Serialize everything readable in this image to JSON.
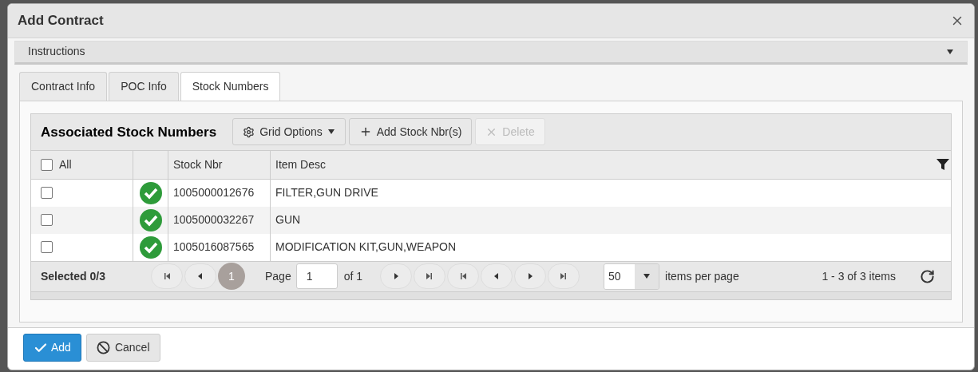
{
  "dialog": {
    "title": "Add Contract"
  },
  "instructions": {
    "label": "Instructions",
    "expanded": false
  },
  "tabs": [
    {
      "label": "Contract Info",
      "selected": false
    },
    {
      "label": "POC Info",
      "selected": false
    },
    {
      "label": "Stock Numbers",
      "selected": true
    }
  ],
  "grid": {
    "title": "Associated Stock Numbers",
    "toolbar": [
      {
        "kind": "menu",
        "label": "Grid Options",
        "disabled": false
      },
      {
        "kind": "add",
        "label": "Add Stock Nbr(s)",
        "disabled": false
      },
      {
        "kind": "delete",
        "label": "Delete",
        "disabled": true
      }
    ],
    "select_all": {
      "label": "All",
      "checked": false
    },
    "columns": [
      "Stock Nbr",
      "Item Desc"
    ],
    "rows": [
      {
        "checked": false,
        "valid": true,
        "stock_nbr": "1005000012676",
        "item_desc": "FILTER,GUN DRIVE"
      },
      {
        "checked": false,
        "valid": true,
        "stock_nbr": "1005000032267",
        "item_desc": "GUN"
      },
      {
        "checked": false,
        "valid": true,
        "stock_nbr": "1005016087565",
        "item_desc": "MODIFICATION KIT,GUN,WEAPON"
      }
    ],
    "pager": {
      "selected_count": "Selected 0/3",
      "pages": [
        {
          "label": "1",
          "selected": true
        }
      ],
      "page_label": "Page",
      "page_value": "1",
      "page_total": "of 1",
      "page_size": "50",
      "page_size_label": "items per page",
      "range": "1 - 3 of 3 items"
    }
  },
  "actions": [
    {
      "kind": "primary",
      "label": "Add"
    },
    {
      "kind": "cancel",
      "label": "Cancel"
    }
  ]
}
